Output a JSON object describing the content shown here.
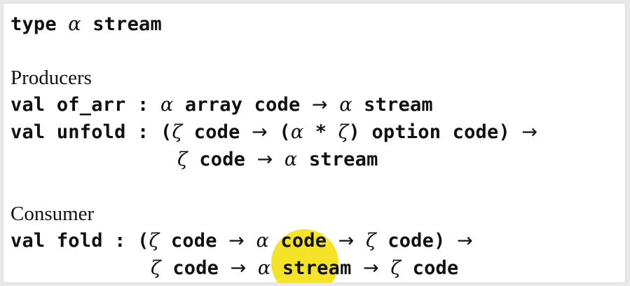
{
  "highlight_color": "#f4e21c",
  "lines": {
    "type_decl": {
      "kw": "type",
      "alpha": "α",
      "name": "stream"
    },
    "producers_heading": "Producers",
    "of_arr": {
      "kw": "val",
      "name": "of_arr",
      "colon": ":",
      "alpha1": "α",
      "t1": "array code",
      "arrow1": "→",
      "alpha2": "α",
      "t2": "stream"
    },
    "unfold1": {
      "kw": "val",
      "name": "unfold",
      "colon": ":",
      "open": "(",
      "zeta1": "ζ",
      "t1": "code",
      "arrow1": "→",
      "open2": "(",
      "alpha1": "α",
      "star": "*",
      "zeta2": "ζ",
      "close2": ")",
      "t2": "option code)",
      "arrow2": "→"
    },
    "unfold2": {
      "zeta": "ζ",
      "t1": "code",
      "arrow": "→",
      "alpha": "α",
      "t2": "stream"
    },
    "consumer_heading": "Consumer",
    "fold1": {
      "kw": "val",
      "name": "fold",
      "colon": ":",
      "open": "(",
      "zeta1": "ζ",
      "t1": "code",
      "arrow1": "→",
      "alpha": "α",
      "t2": "code",
      "arrow2": "→",
      "zeta2": "ζ",
      "t3": "code)",
      "arrow3": "→"
    },
    "fold2": {
      "zeta1": "ζ",
      "t1": "code",
      "arrow1": "→",
      "alpha": "α",
      "t2": "stream",
      "arrow2": "→",
      "zeta2": "ζ",
      "t3": "code"
    }
  }
}
